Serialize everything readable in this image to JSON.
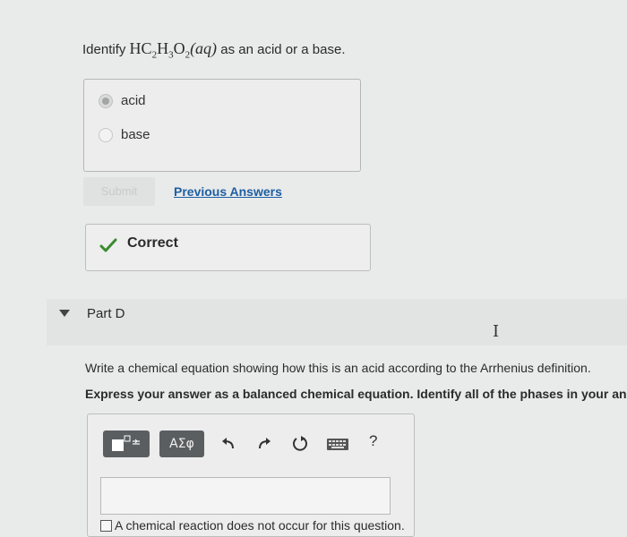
{
  "question": {
    "prefix": "Identify",
    "formula": {
      "H": "H",
      "C": "C",
      "c_sub": "2",
      "H2": "H",
      "h_sub": "3",
      "O": "O",
      "o_sub": "2",
      "phase": "(aq)"
    },
    "suffix": "as an acid or a base."
  },
  "choices": [
    {
      "label": "acid",
      "selected": true
    },
    {
      "label": "base",
      "selected": false
    }
  ],
  "submit_label": "Submit",
  "previous_answers_label": "Previous Answers",
  "feedback": {
    "label": "Correct",
    "color": "#3a8a2e"
  },
  "part": {
    "label": "Part D"
  },
  "instructions": "Write a chemical equation showing how this is an acid according to the Arrhenius definition.",
  "express": "Express your answer as a balanced chemical equation. Identify all of the phases in your an",
  "editor": {
    "greek_label": "ΑΣφ",
    "help_label": "?",
    "no_reaction_label": "A chemical reaction does not occur for this question."
  },
  "colors": {
    "link": "#1d5fa3",
    "button_dark": "#5b5e61"
  }
}
